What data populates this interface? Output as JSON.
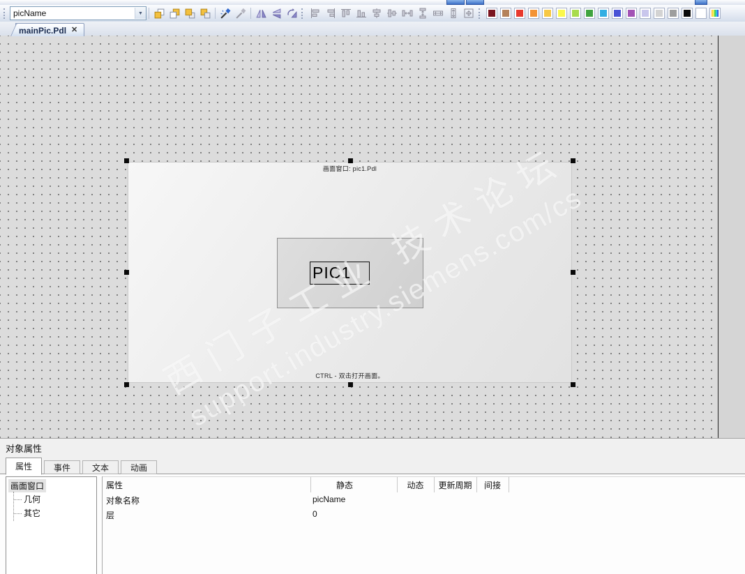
{
  "toolbar": {
    "object_selector": {
      "value": "picName"
    },
    "combo_arrow_glyph": "▼",
    "layer_tools": [
      "bring-to-front",
      "send-to-back",
      "bring-forward",
      "send-backward"
    ],
    "picker_tools": [
      "copy-properties-eyedropper",
      "apply-properties-eyedropper"
    ],
    "transform_tools": [
      "flip-horizontal",
      "flip-vertical",
      "rotate"
    ],
    "align_tools": [
      "align-left",
      "align-right",
      "align-top",
      "align-bottom",
      "center-vertical",
      "center-horizontal",
      "distribute-horizontal",
      "distribute-vertical",
      "same-width",
      "same-height",
      "same-size"
    ],
    "colors": [
      "#7a1420",
      "#b5825a",
      "#e8392e",
      "#f49335",
      "#f7c844",
      "#fbf84c",
      "#a8dc4c",
      "#3fa33f",
      "#33aee3",
      "#4953d6",
      "#a253b5",
      "#c9c6ec",
      "#d3d3d3",
      "#9e9e9e",
      "#0a0a0a",
      "#ffffff"
    ]
  },
  "document_tabs": [
    {
      "label": "mainPic.Pdl",
      "close_glyph": "✕",
      "active": true
    }
  ],
  "canvas": {
    "picture_window": {
      "header": "画面窗口: pic1.Pdl",
      "button_label": "PIC1",
      "hint": "CTRL - 双击打开画面。"
    },
    "watermark": {
      "line1": "西门子工业 技术论坛",
      "line2": "support.industry.siemens.com/cs"
    }
  },
  "properties_panel": {
    "title": "对象属性",
    "tabs": [
      {
        "label": "属性",
        "active": true
      },
      {
        "label": "事件",
        "active": false
      },
      {
        "label": "文本",
        "active": false
      },
      {
        "label": "动画",
        "active": false
      }
    ],
    "tree": {
      "root": "画面窗口",
      "children": [
        "几何",
        "其它"
      ]
    },
    "grid": {
      "headers": [
        "属性",
        "静态",
        "动态",
        "更新周期",
        "间接"
      ],
      "rows": [
        {
          "attribute": "对象名称",
          "static": "picName",
          "dynamic": "",
          "update_cycle": "",
          "indirect": ""
        },
        {
          "attribute": "层",
          "static": "0",
          "dynamic": "",
          "update_cycle": "",
          "indirect": ""
        }
      ]
    }
  }
}
